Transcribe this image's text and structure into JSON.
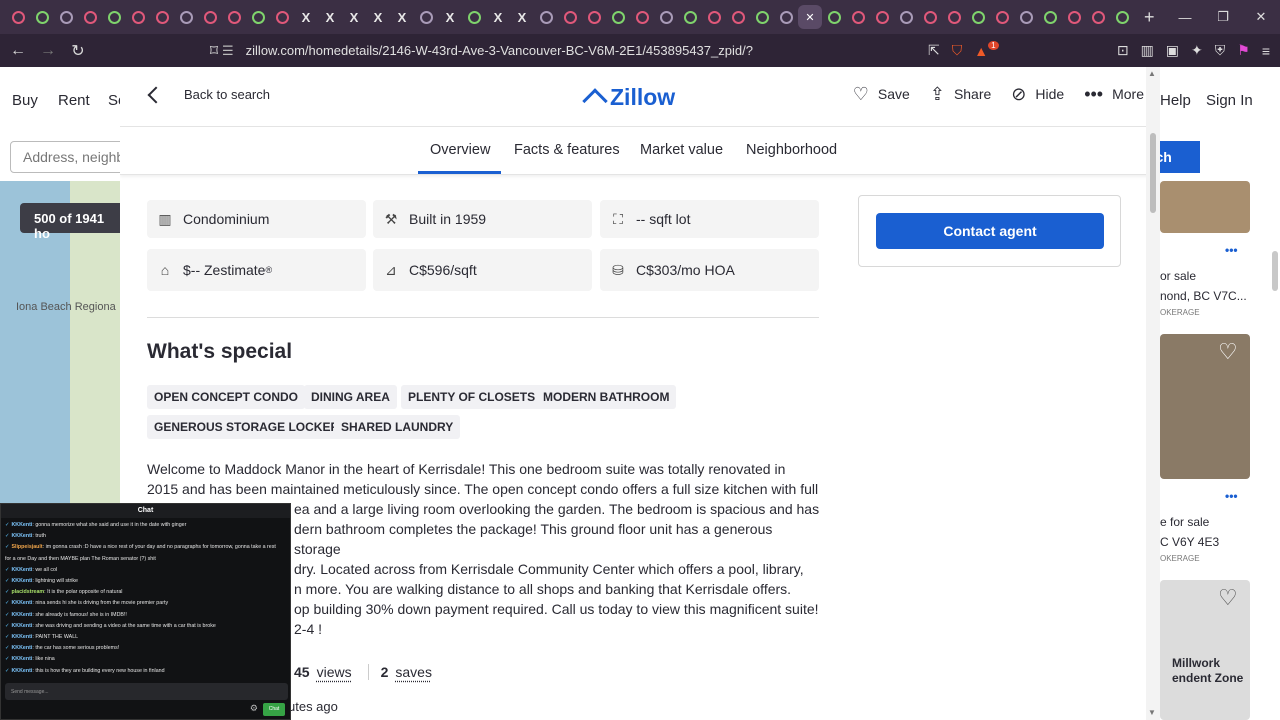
{
  "browser": {
    "tabs": [
      "tab",
      "tab",
      "tab",
      "tab",
      "tab",
      "tab",
      "tab",
      "tab",
      "tab",
      "tab",
      "tab",
      "tab",
      "tab",
      "tab",
      "tab",
      "tab",
      "tab",
      "tab",
      "tab",
      "tab",
      "tab",
      "tab",
      "tab",
      "tab",
      "tab",
      "tab",
      "tab",
      "tab",
      "tab",
      "tab",
      "tab",
      "tab",
      "tab",
      "tab",
      "tab",
      "tab",
      "tab",
      "tab",
      "tab",
      "tab",
      "tab",
      "tab",
      "tab",
      "tab",
      "tab",
      "tab",
      "tab"
    ],
    "tab_glyphs": [
      "",
      "",
      "",
      "",
      "",
      "",
      "",
      "",
      "",
      "",
      "",
      "",
      "X",
      "X",
      "X",
      "X",
      "X",
      "",
      "X",
      "",
      "X",
      "X",
      "",
      "",
      "",
      "",
      "",
      "",
      "",
      "",
      "",
      "",
      "",
      "",
      "",
      "",
      "",
      "",
      "",
      "",
      "",
      "",
      "",
      "",
      "",
      "",
      ""
    ],
    "active_tab_glyph": "✕",
    "new_tab": "+",
    "url": "zillow.com/homedetails/2146-W-43rd-Ave-3-Vancouver-BC-V6M-2E1/453895437_zpid/?",
    "brave_badge": "1"
  },
  "background": {
    "nav": [
      "Buy",
      "Rent",
      "Se",
      "Help",
      "Sign In"
    ],
    "search_placeholder": "Address, neighb",
    "search_button": "rch",
    "results_count": "500 of 1941 ho",
    "map_label": "Iona Beach Regiona",
    "cards": [
      {
        "line1": "or sale",
        "line2": "nond, BC V7C...",
        "line3": "OKERAGE"
      },
      {
        "line1": "e for sale",
        "line2": "C V6Y 4E3",
        "line3": "OKERAGE"
      },
      {
        "line1": "Millwork",
        "line2": "endent  Zone",
        "line3": ""
      }
    ]
  },
  "modal": {
    "back": "Back to search",
    "logo": "Zillow",
    "actions": {
      "save": "Save",
      "share": "Share",
      "hide": "Hide",
      "more": "More"
    },
    "tabs": [
      "Overview",
      "Facts & features",
      "Market value",
      "Neighborhood"
    ],
    "facts": [
      {
        "label": "Condominium",
        "icon": "building-icon"
      },
      {
        "label": "Built in 1959",
        "icon": "hammer-icon"
      },
      {
        "label": "-- sqft lot",
        "icon": "lot-icon"
      },
      {
        "label": "$-- Zestimate",
        "icon": "zestimate-icon"
      },
      {
        "label": "C$596/sqft",
        "icon": "ruler-icon"
      },
      {
        "label": "C$303/mo HOA",
        "icon": "hoa-icon"
      }
    ],
    "zestimate_mark": "®",
    "contact": "Contact agent",
    "special_title": "What's special",
    "chips": [
      "OPEN CONCEPT CONDO",
      "DINING AREA",
      "PLENTY OF CLOSETS",
      "MODERN BATHROOM",
      "GENEROUS STORAGE LOCKER",
      "SHARED LAUNDRY"
    ],
    "description": [
      "Welcome to Maddock Manor in the heart of Kerrisdale! This one bedroom suite was totally renovated in",
      "2015 and has been maintained meticulously since. The open concept condo offers a full size kitchen with full",
      "ea and a large living room overlooking the garden. The bedroom is spacious and has",
      "dern bathroom completes the package! This ground floor unit has a generous storage",
      "dry. Located across from Kerrisdale Community Center which offers a pool, library,",
      "n more. You are walking distance to all shops and banking that Kerrisdale offers.",
      "op building 30% down payment required. Call us today to view this magnificent suite!",
      "2-4 !"
    ],
    "stats": {
      "views_count": "45",
      "views_label": "views",
      "saves_count": "2",
      "saves_label": "saves"
    },
    "ago": "utes ago"
  },
  "chat": {
    "title": "Chat",
    "messages": [
      {
        "user": "KKKenti",
        "color": "#7ec8ff",
        "text": "gonna memorize what she said and use it in the date with ginger"
      },
      {
        "user": "KKKenti",
        "color": "#7ec8ff",
        "text": "truth"
      },
      {
        "user": "Slippeisjault",
        "color": "#f0a54a",
        "text": "im gonna crash :D have a nice rest of your day and no paragraphs for tomorrow, gonna take a rest"
      },
      {
        "user": "",
        "color": "#e6e6e6",
        "text": "for a one Day and then MAYBE plan The Roman senator (?) shit"
      },
      {
        "user": "KKKenti",
        "color": "#7ec8ff",
        "text": "we all col"
      },
      {
        "user": "KKKenti",
        "color": "#7ec8ff",
        "text": "lightning will strike"
      },
      {
        "user": "placidstream",
        "color": "#a8e06a",
        "text": "It is the polar opposite of natural"
      },
      {
        "user": "KKKenti",
        "color": "#7ec8ff",
        "text": "nina sends hi she is driving from the movie premier party"
      },
      {
        "user": "KKKenti",
        "color": "#7ec8ff",
        "text": "she already is famous! she is in IMDB!!"
      },
      {
        "user": "KKKenti",
        "color": "#7ec8ff",
        "text": "she was driving and sending a video at the same time with a car that is broke"
      },
      {
        "user": "KKKenti",
        "color": "#7ec8ff",
        "text": "PAINT THE WALL"
      },
      {
        "user": "KKKenti",
        "color": "#7ec8ff",
        "text": "the car has some serious problems!"
      },
      {
        "user": "KKKenti",
        "color": "#7ec8ff",
        "text": "like nina"
      },
      {
        "user": "KKKenti",
        "color": "#7ec8ff",
        "text": "this is how they are building every new house in finland"
      }
    ],
    "input_placeholder": "Send message...",
    "send": "Chat"
  }
}
